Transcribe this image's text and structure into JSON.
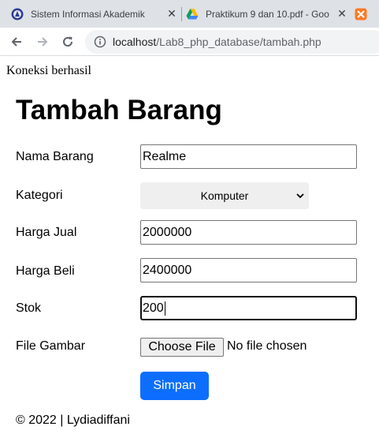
{
  "browser": {
    "tabs": [
      {
        "title": "Sistem Informasi Akademik",
        "icon": "university-crest-icon"
      },
      {
        "title": "Praktikum 9 dan 10.pdf - Goo",
        "icon": "google-drive-icon"
      },
      {
        "title": "",
        "icon": "xampp-icon"
      }
    ],
    "url_host": "localhost",
    "url_path": "/Lab8_php_database/tambah.php"
  },
  "page": {
    "status_text": "Koneksi berhasil",
    "heading": "Tambah Barang",
    "form": {
      "nama_label": "Nama Barang",
      "nama_value": "Realme",
      "kategori_label": "Kategori",
      "kategori_selected": "Komputer",
      "harga_jual_label": "Harga Jual",
      "harga_jual_value": "2000000",
      "harga_beli_label": "Harga Beli",
      "harga_beli_value": "2400000",
      "stok_label": "Stok",
      "stok_value": "200",
      "gambar_label": "File Gambar",
      "file_button": "Choose File",
      "file_status": "No file chosen",
      "submit_label": "Simpan"
    },
    "footer": "© 2022 | Lydiadiffani"
  },
  "colors": {
    "tabstrip_bg": "#dee1e6",
    "submit_bg": "#0d6efd"
  }
}
